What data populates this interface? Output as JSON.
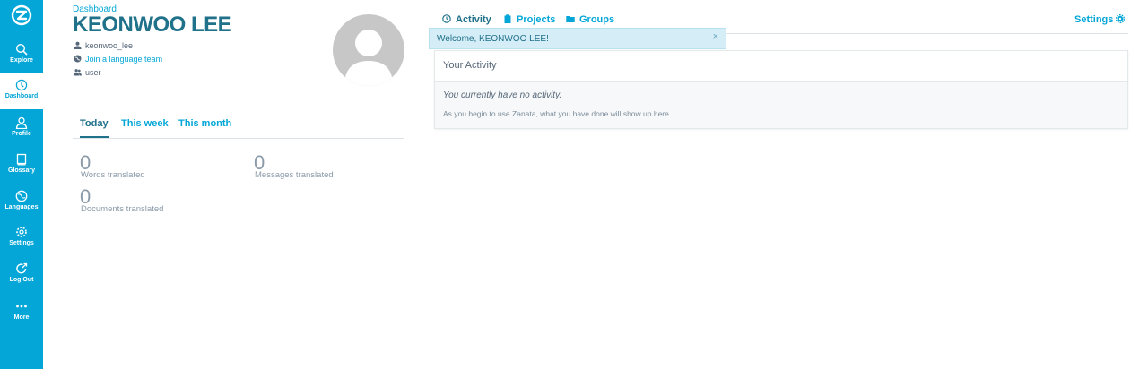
{
  "sidebar": {
    "items": [
      {
        "label": "Explore",
        "icon": "search-icon"
      },
      {
        "label": "Dashboard",
        "icon": "dashboard-icon"
      },
      {
        "label": "Profile",
        "icon": "user-icon"
      },
      {
        "label": "Glossary",
        "icon": "book-icon"
      },
      {
        "label": "Languages",
        "icon": "globe-icon"
      },
      {
        "label": "Settings",
        "icon": "gear-icon"
      },
      {
        "label": "Log Out",
        "icon": "logout-icon"
      },
      {
        "label": "More",
        "icon": "more-icon"
      }
    ],
    "active": "Dashboard",
    "color": "#03a6d7"
  },
  "profile": {
    "breadcrumb": "Dashboard",
    "name": "KEONWOO LEE",
    "username": "keonwoo_lee",
    "join_link": "Join a language team",
    "role": "user"
  },
  "stats": {
    "tabs": [
      "Today",
      "This week",
      "This month"
    ],
    "active_tab": "Today",
    "items": [
      {
        "value": "0",
        "label": "Words translated"
      },
      {
        "value": "0",
        "label": "Messages translated"
      },
      {
        "value": "0",
        "label": "Documents translated"
      }
    ]
  },
  "topnav": {
    "activity": "Activity",
    "projects": "Projects",
    "groups": "Groups",
    "settings": "Settings"
  },
  "alert": {
    "message": "Welcome, KEONWOO LEE!",
    "close": "×"
  },
  "activity_panel": {
    "title": "Your Activity",
    "empty_message": "You currently have no activity.",
    "hint": "As you begin to use Zanata, what you have done will show up here."
  }
}
